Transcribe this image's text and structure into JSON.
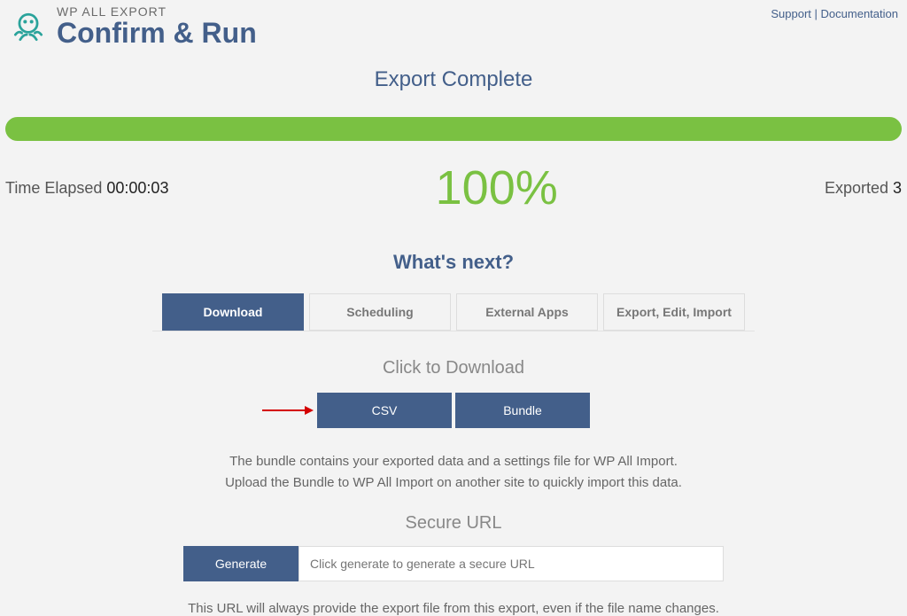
{
  "header": {
    "brand_small": "WP ALL EXPORT",
    "brand_title": "Confirm & Run",
    "support_link": "Support",
    "separator": " | ",
    "docs_link": "Documentation"
  },
  "status": {
    "title": "Export Complete",
    "time_label": "Time Elapsed ",
    "time_value": "00:00:03",
    "percent": "100%",
    "exported_label": "Exported ",
    "exported_value": "3"
  },
  "next": {
    "title": "What's next?",
    "tabs": {
      "download": "Download",
      "scheduling": "Scheduling",
      "external": "External Apps",
      "eei": "Export, Edit, Import"
    }
  },
  "download": {
    "title": "Click to Download",
    "csv": "CSV",
    "bundle": "Bundle",
    "desc_line1": "The bundle contains your exported data and a settings file for WP All Import.",
    "desc_line2": "Upload the Bundle to WP All Import on another site to quickly import this data."
  },
  "secure": {
    "title": "Secure URL",
    "generate": "Generate",
    "placeholder": "Click generate to generate a secure URL",
    "desc": "This URL will always provide the export file from this export, even if the file name changes."
  }
}
